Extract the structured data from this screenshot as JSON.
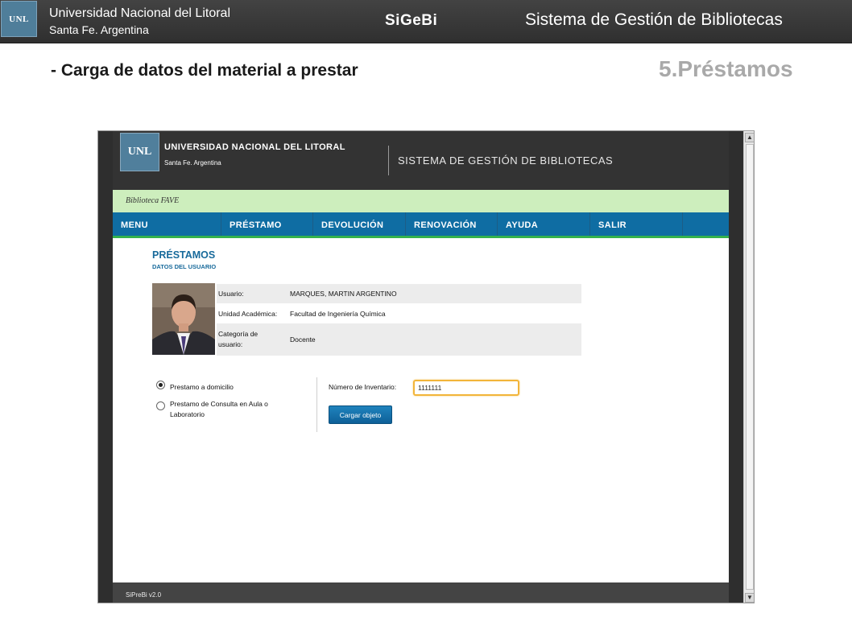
{
  "slide": {
    "logo_text": "UNL",
    "university": "Universidad Nacional del Litoral",
    "city": "Santa Fe. Argentina",
    "brand": "SiGeBi",
    "system_title": "Sistema de Gestión de Bibliotecas",
    "subtitle": "- Carga de datos del material a prestar",
    "section": "5.Préstamos"
  },
  "app": {
    "logo_text": "UNL",
    "university": "UNIVERSIDAD NACIONAL DEL LITORAL",
    "city": "Santa Fe. Argentina",
    "system_title": "SISTEMA DE GESTIÓN DE BIBLIOTECAS",
    "library": "Biblioteca FAVE",
    "nav": [
      "MENU",
      "PRÉSTAMO",
      "DEVOLUCIÓN",
      "RENOVACIÓN",
      "AYUDA",
      "SALIR"
    ],
    "page_title": "PRÉSTAMOS",
    "page_subtitle": "DATOS DEL USUARIO",
    "user": {
      "rows": [
        {
          "label": "Usuario:",
          "value": "MARQUES, MARTIN ARGENTINO"
        },
        {
          "label": "Unidad Académica:",
          "value": "Facultad de Ingeniería Química"
        },
        {
          "label": "Categoría de usuario:",
          "label_line1": "Categoría de",
          "label_line2": "usuario:",
          "value": "Docente"
        }
      ]
    },
    "loan_types": [
      {
        "label": "Prestamo a domicilio",
        "selected": true
      },
      {
        "label": "Prestamo de Consulta en Aula o Laboratorio",
        "label_line1": "Prestamo de Consulta en Aula o",
        "label_line2": "Laboratorio",
        "selected": false
      }
    ],
    "inventory": {
      "label": "Número de Inventario:",
      "value": "1111111"
    },
    "load_button": "Cargar objeto",
    "version": "SiPreBi v2.0"
  },
  "colors": {
    "nav_blue": "#0f6da3",
    "nav_underline": "#34b24d",
    "library_bar": "#cdeebd",
    "heading_blue": "#186a9b",
    "input_focus": "#f2b53a"
  }
}
